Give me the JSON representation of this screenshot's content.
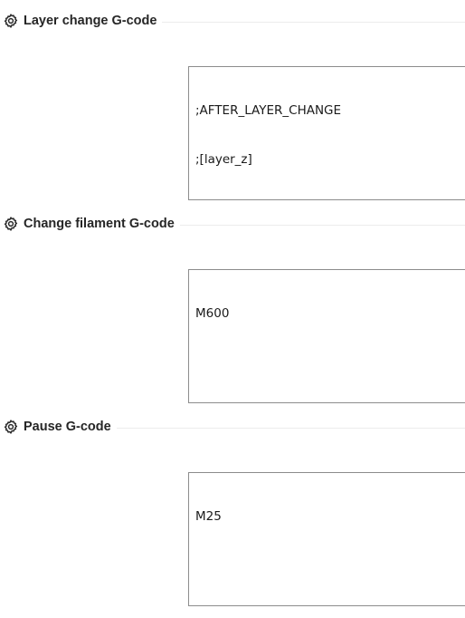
{
  "sections": [
    {
      "title": "Layer change G-code",
      "icon": "gear-icon",
      "lines": [
        ";AFTER_LAYER_CHANGE",
        ";[layer_z]"
      ]
    },
    {
      "title": "Change filament G-code",
      "icon": "gear-icon",
      "lines": [
        "M600"
      ]
    },
    {
      "title": "Pause G-code",
      "icon": "gear-icon",
      "lines": [
        "M25"
      ]
    }
  ]
}
